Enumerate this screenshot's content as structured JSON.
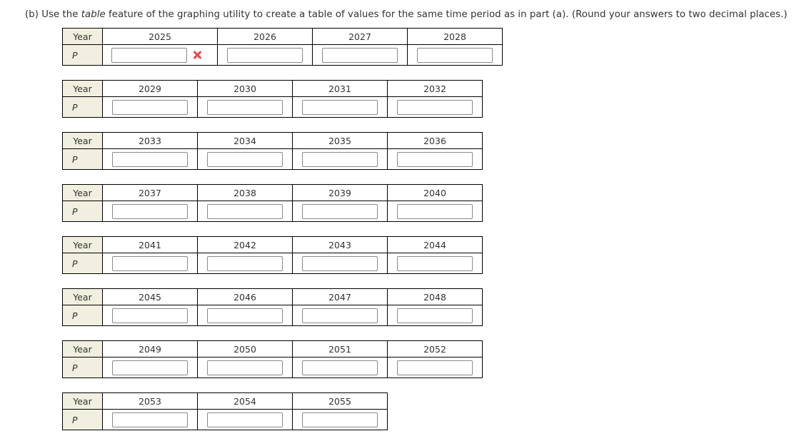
{
  "instruction": {
    "prefix": "(b) Use the ",
    "emphasis": "table",
    "suffix": " feature of the graphing utility to create a table of values for the same time period as in part (a). (Round your answers to two decimal places.)"
  },
  "labels": {
    "year": "Year",
    "p": "P"
  },
  "tables": [
    {
      "years": [
        "2025",
        "2026",
        "2027",
        "2028"
      ],
      "values": [
        "",
        "",
        "",
        ""
      ],
      "status": [
        "incorrect",
        "",
        "",
        ""
      ]
    },
    {
      "years": [
        "2029",
        "2030",
        "2031",
        "2032"
      ],
      "values": [
        "",
        "",
        "",
        ""
      ]
    },
    {
      "years": [
        "2033",
        "2034",
        "2035",
        "2036"
      ],
      "values": [
        "",
        "",
        "",
        ""
      ]
    },
    {
      "years": [
        "2037",
        "2038",
        "2039",
        "2040"
      ],
      "values": [
        "",
        "",
        "",
        ""
      ]
    },
    {
      "years": [
        "2041",
        "2042",
        "2043",
        "2044"
      ],
      "values": [
        "",
        "",
        "",
        ""
      ]
    },
    {
      "years": [
        "2045",
        "2046",
        "2047",
        "2048"
      ],
      "values": [
        "",
        "",
        "",
        ""
      ]
    },
    {
      "years": [
        "2049",
        "2050",
        "2051",
        "2052"
      ],
      "values": [
        "",
        "",
        "",
        ""
      ]
    },
    {
      "years": [
        "2053",
        "2054",
        "2055"
      ],
      "values": [
        "",
        "",
        ""
      ]
    }
  ],
  "icons": {
    "incorrect": "red-x-icon"
  },
  "colors": {
    "label_bg": "#f1efdf",
    "incorrect": "#e8454a"
  }
}
